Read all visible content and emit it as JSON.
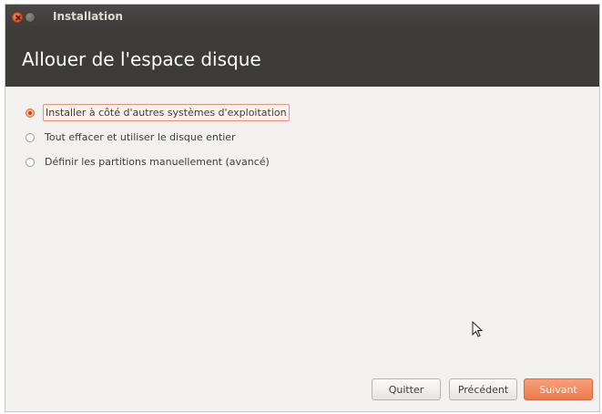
{
  "window": {
    "title": "Installation"
  },
  "header": {
    "title": "Allouer de l'espace disque"
  },
  "options": [
    {
      "label": "Installer à côté d'autres systèmes d'exploitation",
      "selected": true
    },
    {
      "label": "Tout effacer et utiliser le disque entier",
      "selected": false
    },
    {
      "label": "Définir les partitions manuellement (avancé)",
      "selected": false
    }
  ],
  "buttons": {
    "quit": "Quitter",
    "previous": "Précédent",
    "next": "Suivant"
  },
  "colors": {
    "accent": "#ec7a4d",
    "header_bg": "#3c3b37",
    "body_bg": "#f2f1f0"
  }
}
